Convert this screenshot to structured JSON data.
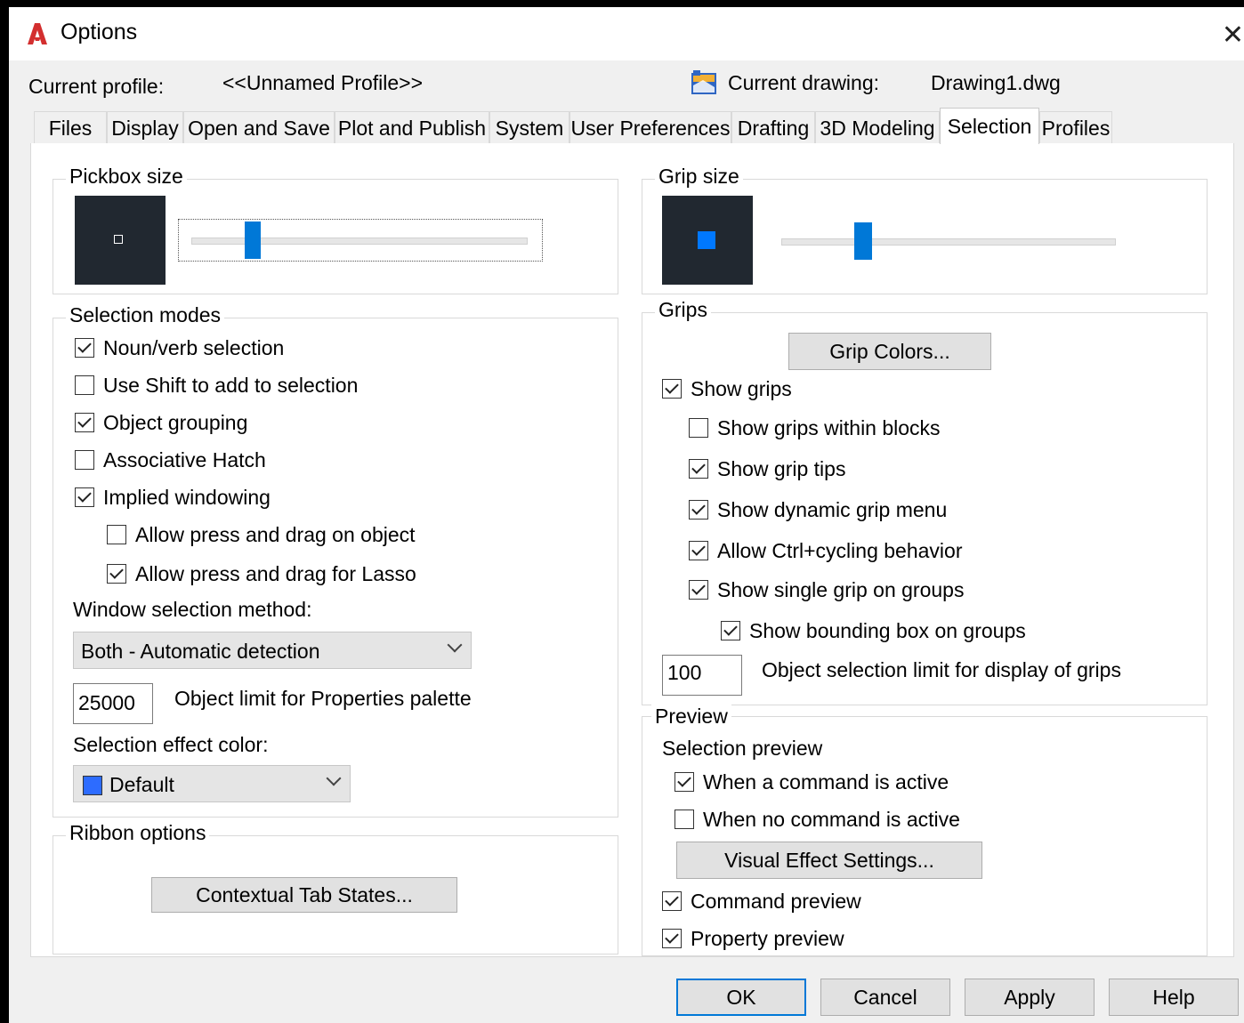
{
  "window": {
    "title": "Options",
    "close_glyph": "✕",
    "icon": "autocad-a-icon"
  },
  "header": {
    "profile_label": "Current profile:",
    "profile_value": "<<Unnamed Profile>>",
    "drawing_label": "Current drawing:",
    "drawing_value": "Drawing1.dwg",
    "drawing_icon": "drawing-icon"
  },
  "tabs": [
    {
      "label": "Files"
    },
    {
      "label": "Display"
    },
    {
      "label": "Open and Save"
    },
    {
      "label": "Plot and Publish"
    },
    {
      "label": "System"
    },
    {
      "label": "User Preferences"
    },
    {
      "label": "Drafting"
    },
    {
      "label": "3D Modeling"
    },
    {
      "label": "Selection",
      "active": true
    },
    {
      "label": "Profiles"
    }
  ],
  "pickbox": {
    "label": "Pickbox size",
    "level": 0.16
  },
  "grip_size": {
    "label": "Grip size",
    "level": 0.22,
    "color": "#0078FF"
  },
  "selection_modes": {
    "label": "Selection modes",
    "options": [
      {
        "label": "Noun/verb selection",
        "checked": true
      },
      {
        "label": "Use Shift to add to selection",
        "checked": false
      },
      {
        "label": "Object grouping",
        "checked": true
      },
      {
        "label": "Associative Hatch",
        "checked": false
      },
      {
        "label": "Implied windowing",
        "checked": true
      },
      {
        "label": "Allow press and drag on object",
        "checked": false
      },
      {
        "label": "Allow press and drag for Lasso",
        "checked": true
      }
    ],
    "window_method_label": "Window selection method:",
    "window_method_value": "Both - Automatic detection",
    "object_limit_value": "25000",
    "object_limit_label": "Object limit for Properties palette",
    "effect_color_label": "Selection effect color:",
    "effect_color_value": "Default",
    "effect_color_swatch": "#2D6CFF"
  },
  "ribbon": {
    "label": "Ribbon options",
    "button": "Contextual Tab States..."
  },
  "grips": {
    "label": "Grips",
    "colors_button": "Grip Colors...",
    "options": [
      {
        "label": "Show grips",
        "checked": true
      },
      {
        "label": "Show grips within blocks",
        "checked": false
      },
      {
        "label": "Show grip tips",
        "checked": true
      },
      {
        "label": "Show dynamic grip menu",
        "checked": true
      },
      {
        "label": "Allow Ctrl+cycling behavior",
        "checked": true
      },
      {
        "label": "Show single grip on groups",
        "checked": true
      },
      {
        "label": "Show bounding box on groups",
        "checked": true
      }
    ],
    "limit_value": "100",
    "limit_label": "Object selection limit for display of grips"
  },
  "preview": {
    "label": "Preview",
    "selection_preview_label": "Selection preview",
    "options": [
      {
        "label": "When a command is active",
        "checked": true
      },
      {
        "label": "When no command is active",
        "checked": false
      }
    ],
    "visual_button": "Visual Effect Settings...",
    "command_preview": {
      "label": "Command preview",
      "checked": true
    },
    "property_preview": {
      "label": "Property preview",
      "checked": true
    }
  },
  "footer": {
    "ok": "OK",
    "cancel": "Cancel",
    "apply": "Apply",
    "help": "Help"
  },
  "colors": {
    "accent": "#0078D7",
    "dark_preview": "#212830"
  }
}
